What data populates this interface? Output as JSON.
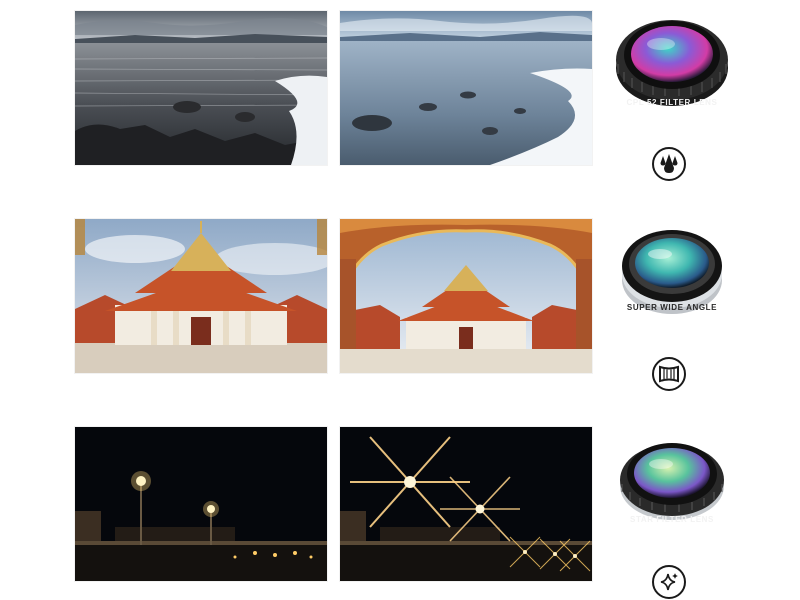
{
  "rows": [
    {
      "id": "cpl",
      "lens_label": "CPL 52 FILTER LENS",
      "mode_icon": "water-drops-icon"
    },
    {
      "id": "wide-angle",
      "lens_label": "SUPER WIDE ANGLE",
      "mode_icon": "wide-angle-icon"
    },
    {
      "id": "star",
      "lens_label": "STAR FILTER LENS",
      "mode_icon": "sparkle-icon"
    }
  ],
  "colors": {
    "background": "#ffffff",
    "icon_stroke": "#1a1a1a"
  }
}
